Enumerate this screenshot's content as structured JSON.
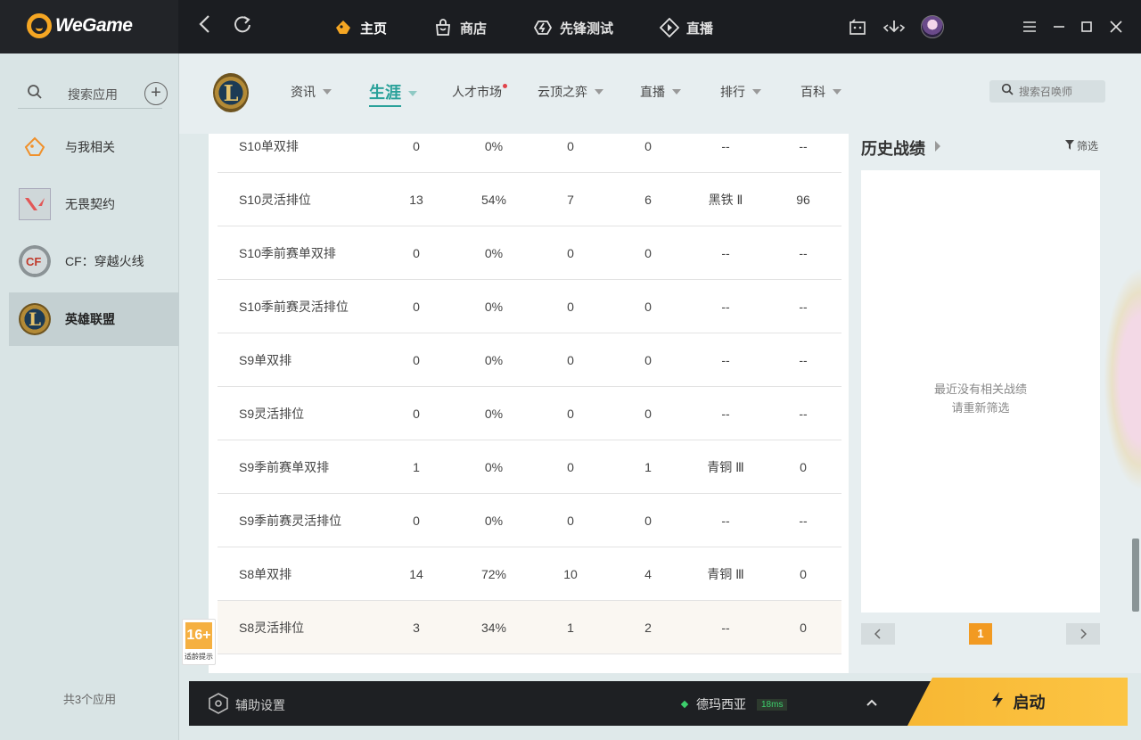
{
  "app": {
    "brand": "WeGame",
    "accent": "#f5a623"
  },
  "topbar": {
    "back_icon": "back-arrow-icon",
    "refresh_icon": "refresh-icon",
    "nav": [
      {
        "label": "主页",
        "icon": "home-icon",
        "active": true
      },
      {
        "label": "商店",
        "icon": "shop-icon"
      },
      {
        "label": "先锋测试",
        "icon": "pioneer-icon"
      },
      {
        "label": "直播",
        "icon": "live-icon"
      }
    ]
  },
  "sidebar": {
    "search_label": "搜索应用",
    "items": [
      {
        "label": "与我相关",
        "icon": "related-icon"
      },
      {
        "label": "无畏契约",
        "icon": "valorant-icon"
      },
      {
        "label": "CF：穿越火线",
        "icon": "crossfire-icon"
      },
      {
        "label": "英雄联盟",
        "icon": "lol-icon",
        "active": true
      }
    ],
    "app_count": "共3个应用"
  },
  "game_header": {
    "tabs": [
      {
        "label": "资讯"
      },
      {
        "label": "生涯",
        "active": true
      },
      {
        "label": "人才市场",
        "dot": true
      },
      {
        "label": "云顶之弈"
      },
      {
        "label": "直播"
      },
      {
        "label": "排行"
      },
      {
        "label": "百科"
      }
    ],
    "search_placeholder": "搜索召唤师"
  },
  "career_table": {
    "rows": [
      {
        "mode": "S10单双排",
        "games": "0",
        "winrate": "0%",
        "wins": "0",
        "losses": "0",
        "tier": "--",
        "points": "--"
      },
      {
        "mode": "S10灵活排位",
        "games": "13",
        "winrate": "54%",
        "wins": "7",
        "losses": "6",
        "tier": "黑铁 Ⅱ",
        "points": "96"
      },
      {
        "mode": "S10季前赛单双排",
        "games": "0",
        "winrate": "0%",
        "wins": "0",
        "losses": "0",
        "tier": "--",
        "points": "--"
      },
      {
        "mode": "S10季前赛灵活排位",
        "games": "0",
        "winrate": "0%",
        "wins": "0",
        "losses": "0",
        "tier": "--",
        "points": "--"
      },
      {
        "mode": "S9单双排",
        "games": "0",
        "winrate": "0%",
        "wins": "0",
        "losses": "0",
        "tier": "--",
        "points": "--"
      },
      {
        "mode": "S9灵活排位",
        "games": "0",
        "winrate": "0%",
        "wins": "0",
        "losses": "0",
        "tier": "--",
        "points": "--"
      },
      {
        "mode": "S9季前赛单双排",
        "games": "1",
        "winrate": "0%",
        "wins": "0",
        "losses": "1",
        "tier": "青铜 Ⅲ",
        "points": "0"
      },
      {
        "mode": "S9季前赛灵活排位",
        "games": "0",
        "winrate": "0%",
        "wins": "0",
        "losses": "0",
        "tier": "--",
        "points": "--"
      },
      {
        "mode": "S8单双排",
        "games": "14",
        "winrate": "72%",
        "wins": "10",
        "losses": "4",
        "tier": "青铜 Ⅲ",
        "points": "0"
      },
      {
        "mode": "S8灵活排位",
        "games": "3",
        "winrate": "34%",
        "wins": "1",
        "losses": "2",
        "tier": "--",
        "points": "0"
      }
    ]
  },
  "history": {
    "title": "历史战绩",
    "filter_label": "筛选",
    "empty_line1": "最近没有相关战绩",
    "empty_line2": "请重新筛选",
    "page": "1"
  },
  "age_badge": {
    "rating": "16+",
    "tip": "适龄提示"
  },
  "bottombar": {
    "assist_label": "辅助设置",
    "server": "德玛西亚",
    "ping": "18ms",
    "launch_label": "启动"
  }
}
